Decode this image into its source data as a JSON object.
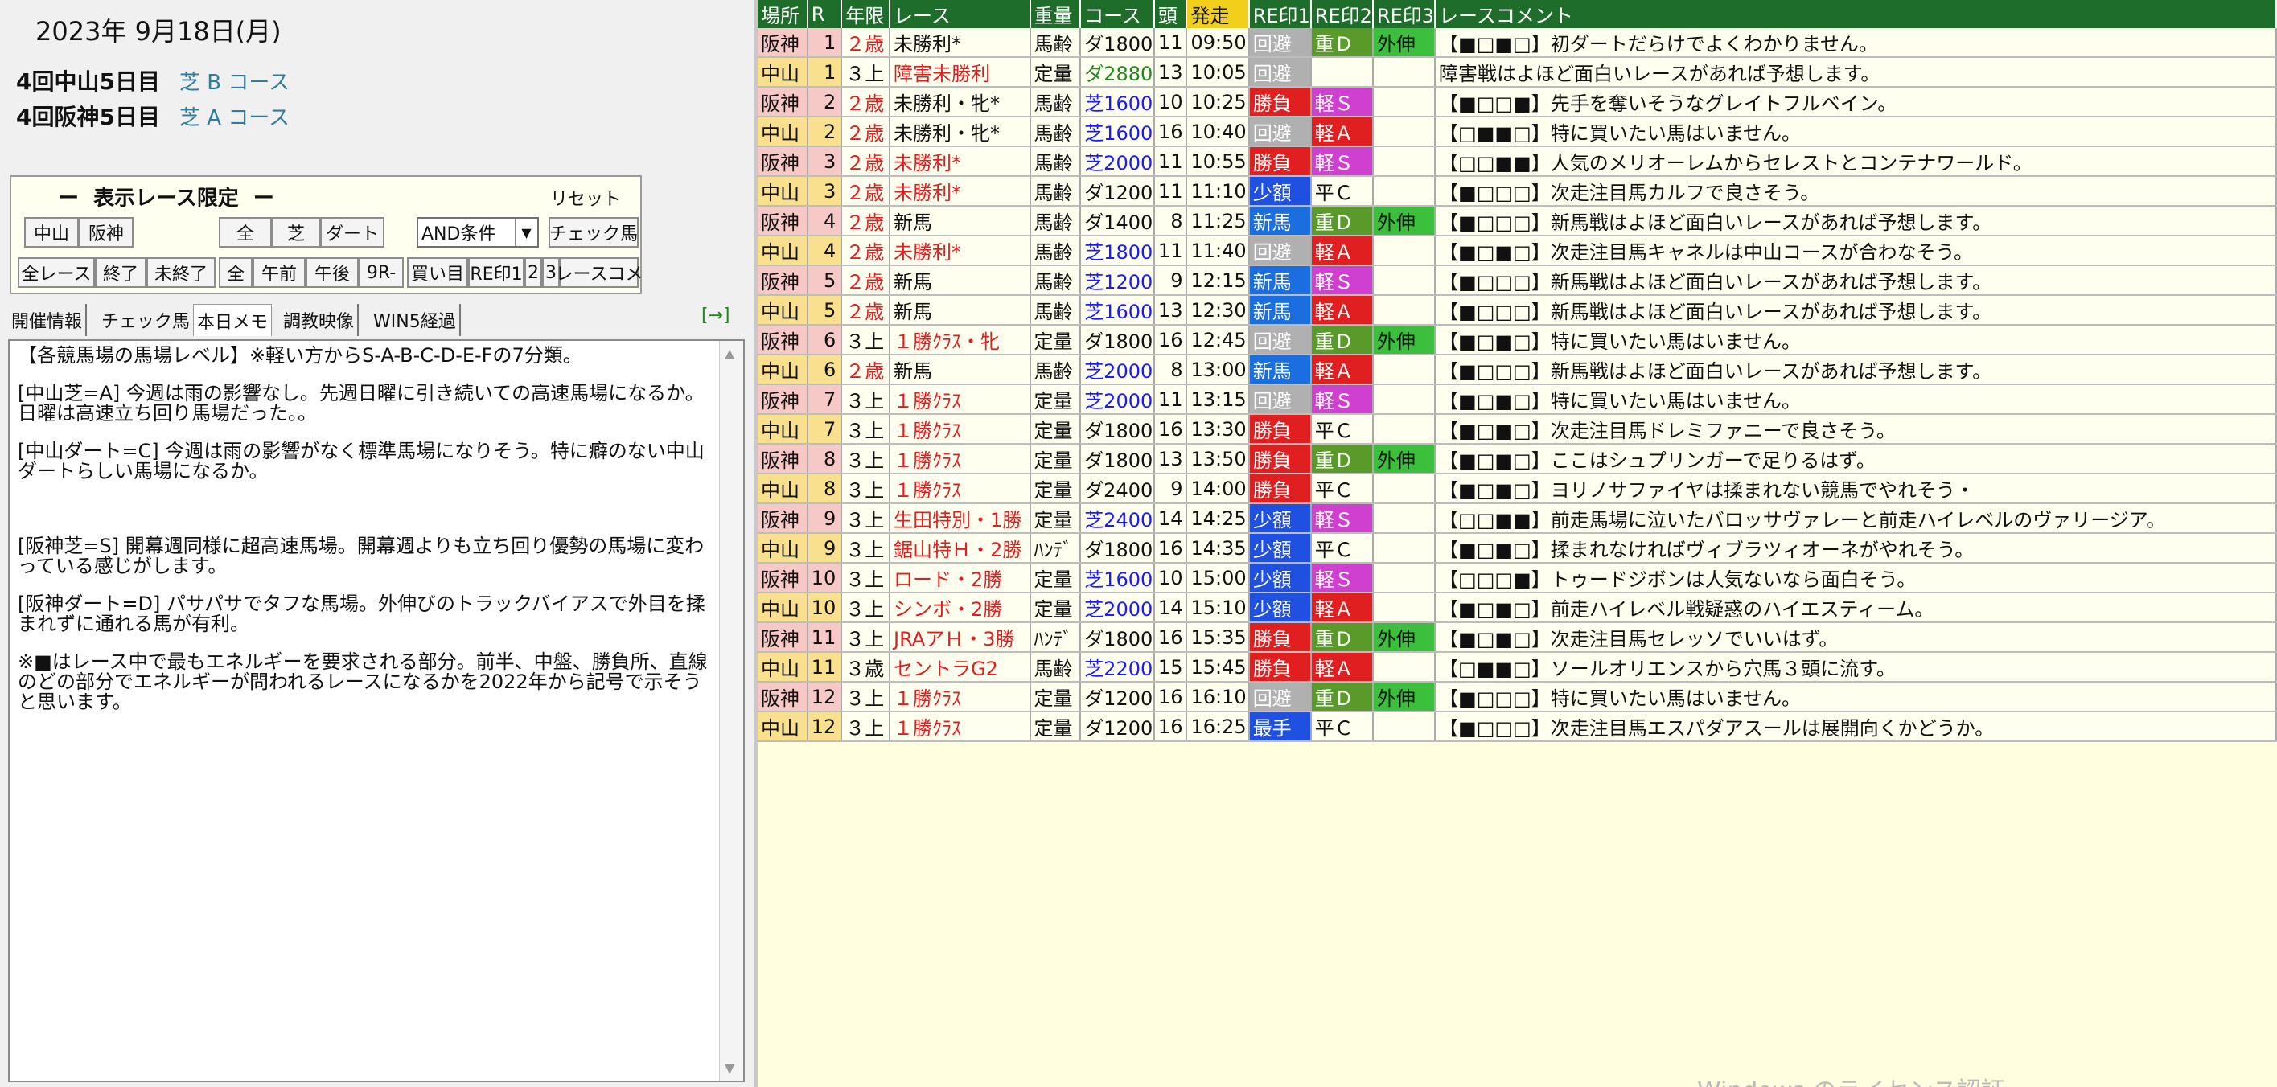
{
  "date": "2023年  9月18日(月)",
  "meetings": [
    {
      "name": "4回中山5日目",
      "course": "芝 B コース"
    },
    {
      "name": "4回阪神5日目",
      "course": "芝 A コース"
    }
  ],
  "filter": {
    "title": "ー  表示レース限定  ー",
    "reset": "リセット",
    "btn_nakayama": "中山",
    "btn_hanshin": "阪神",
    "btn_all": "全",
    "btn_turf": "芝",
    "btn_dirt": "ダート",
    "condition": "AND条件",
    "btn_check": "チェック馬",
    "btn_all_races": "全レース",
    "btn_finished": "終了",
    "btn_unfinished": "未終了",
    "btn_all2": "全",
    "btn_am": "午前",
    "btn_pm": "午後",
    "btn_9r": "9R-",
    "btn_buy": "買い目",
    "btn_rei1": "RE印1",
    "btn_2": "2",
    "btn_3": "3",
    "btn_comment": "レースコメ"
  },
  "tabs": {
    "t1": "開催情報",
    "t2": "チェック馬",
    "t3": "本日メモ",
    "t4": "調教映像",
    "t5": "WIN5経過",
    "arrow": "[→]"
  },
  "memo": [
    "【各競馬場の馬場レベル】※軽い方からS-A-B-C-D-E-Fの7分類。",
    "[中山芝=A] 今週は雨の影響なし。先週日曜に引き続いての高速馬場になるか。日曜は高速立ち回り馬場だった。。",
    "[中山ダート=C] 今週は雨の影響がなく標準馬場になりそう。特に癖のない中山ダートらしい馬場になるか。",
    "",
    "[阪神芝=S] 開幕週同様に超高速馬場。開幕週よりも立ち回り優勢の馬場に変わっている感じがします。",
    "[阪神ダート=D] パサパサでタフな馬場。外伸びのトラックバイアスで外目を揉まれずに通れる馬が有利。",
    "※■はレース中で最もエネルギーを要求される部分。前半、中盤、勝負所、直線のどの部分でエネルギーが問われるレースになるかを2022年から記号で示そうと思います。"
  ],
  "table": {
    "headers": [
      "場所",
      "R",
      "年限",
      "レース",
      "重量",
      "コース",
      "頭",
      "発走",
      "RE印1",
      "RE印2",
      "RE印3",
      "レースコメント"
    ],
    "rows": [
      {
        "place": "阪神",
        "r": "1",
        "age": "２歳",
        "race": "未勝利*",
        "weight": "馬齢",
        "course": "ダ1800",
        "heads": "11",
        "time": "09:50",
        "r1": "回避",
        "r2": "重Ｄ",
        "r3": "外伸",
        "comment": "【■□■□】初ダートだらけでよくわかりません。"
      },
      {
        "place": "中山",
        "r": "1",
        "age": "３上",
        "race": "障害未勝利",
        "weight": "定量",
        "course": "ダ2880",
        "heads": "13",
        "time": "10:05",
        "r1": "回避",
        "r2": "",
        "r3": "",
        "comment": "障害戦はよほど面白いレースがあれば予想します。"
      },
      {
        "place": "阪神",
        "r": "2",
        "age": "２歳",
        "race": "未勝利・牝*",
        "weight": "馬齢",
        "course": "芝1600",
        "heads": "10",
        "time": "10:25",
        "r1": "勝負",
        "r2": "軽Ｓ",
        "r3": "",
        "comment": "【■□□■】先手を奪いそうなグレイトフルベイン。"
      },
      {
        "place": "中山",
        "r": "2",
        "age": "２歳",
        "race": "未勝利・牝*",
        "weight": "馬齢",
        "course": "芝1600",
        "heads": "16",
        "time": "10:40",
        "r1": "回避",
        "r2": "軽Ａ",
        "r3": "",
        "comment": "【□■■□】特に買いたい馬はいません。"
      },
      {
        "place": "阪神",
        "r": "3",
        "age": "２歳",
        "race": "未勝利*",
        "weight": "馬齢",
        "course": "芝2000",
        "heads": "11",
        "time": "10:55",
        "r1": "勝負",
        "r2": "軽Ｓ",
        "r3": "",
        "comment": "【□□■■】人気のメリオーレムからセレストとコンテナワールド。"
      },
      {
        "place": "中山",
        "r": "3",
        "age": "２歳",
        "race": "未勝利*",
        "weight": "馬齢",
        "course": "ダ1200",
        "heads": "11",
        "time": "11:10",
        "r1": "少額",
        "r2": "平Ｃ",
        "r3": "",
        "comment": "【■□□□】次走注目馬カルフで良さそう。"
      },
      {
        "place": "阪神",
        "r": "4",
        "age": "２歳",
        "race": "新馬",
        "weight": "馬齢",
        "course": "ダ1400",
        "heads": "8",
        "time": "11:25",
        "r1": "新馬",
        "r2": "重Ｄ",
        "r3": "外伸",
        "comment": "【■□□□】新馬戦はよほど面白いレースがあれば予想します。"
      },
      {
        "place": "中山",
        "r": "4",
        "age": "２歳",
        "race": "未勝利*",
        "weight": "馬齢",
        "course": "芝1800",
        "heads": "11",
        "time": "11:40",
        "r1": "回避",
        "r2": "軽Ａ",
        "r3": "",
        "comment": "【■□■□】次走注目馬キャネルは中山コースが合わなそう。"
      },
      {
        "place": "阪神",
        "r": "5",
        "age": "２歳",
        "race": "新馬",
        "weight": "馬齢",
        "course": "芝1200",
        "heads": "9",
        "time": "12:15",
        "r1": "新馬",
        "r2": "軽Ｓ",
        "r3": "",
        "comment": "【■□□□】新馬戦はよほど面白いレースがあれば予想します。"
      },
      {
        "place": "中山",
        "r": "5",
        "age": "２歳",
        "race": "新馬",
        "weight": "馬齢",
        "course": "芝1600",
        "heads": "13",
        "time": "12:30",
        "r1": "新馬",
        "r2": "軽Ａ",
        "r3": "",
        "comment": "【■□□□】新馬戦はよほど面白いレースがあれば予想します。"
      },
      {
        "place": "阪神",
        "r": "6",
        "age": "３上",
        "race": "１勝ｸﾗｽ・牝",
        "weight": "定量",
        "course": "ダ1800",
        "heads": "16",
        "time": "12:45",
        "r1": "回避",
        "r2": "重Ｄ",
        "r3": "外伸",
        "comment": "【■□■□】特に買いたい馬はいません。"
      },
      {
        "place": "中山",
        "r": "6",
        "age": "２歳",
        "race": "新馬",
        "weight": "馬齢",
        "course": "芝2000",
        "heads": "8",
        "time": "13:00",
        "r1": "新馬",
        "r2": "軽Ａ",
        "r3": "",
        "comment": "【■□□□】新馬戦はよほど面白いレースがあれば予想します。"
      },
      {
        "place": "阪神",
        "r": "7",
        "age": "３上",
        "race": "１勝ｸﾗｽ",
        "weight": "定量",
        "course": "芝2000",
        "heads": "11",
        "time": "13:15",
        "r1": "回避",
        "r2": "軽Ｓ",
        "r3": "",
        "comment": "【■□■□】特に買いたい馬はいません。"
      },
      {
        "place": "中山",
        "r": "7",
        "age": "３上",
        "race": "１勝ｸﾗｽ",
        "weight": "定量",
        "course": "ダ1800",
        "heads": "16",
        "time": "13:30",
        "r1": "勝負",
        "r2": "平Ｃ",
        "r3": "",
        "comment": "【■□■□】次走注目馬ドレミファニーで良さそう。"
      },
      {
        "place": "阪神",
        "r": "8",
        "age": "３上",
        "race": "１勝ｸﾗｽ",
        "weight": "定量",
        "course": "ダ1800",
        "heads": "13",
        "time": "13:50",
        "r1": "勝負",
        "r2": "重Ｄ",
        "r3": "外伸",
        "comment": "【■□■□】ここはシュプリンガーで足りるはず。"
      },
      {
        "place": "中山",
        "r": "8",
        "age": "３上",
        "race": "１勝ｸﾗｽ",
        "weight": "定量",
        "course": "ダ2400",
        "heads": "9",
        "time": "14:00",
        "r1": "勝負",
        "r2": "平Ｃ",
        "r3": "",
        "comment": "【■□■□】ヨリノサファイヤは揉まれない競馬でやれそう・"
      },
      {
        "place": "阪神",
        "r": "9",
        "age": "３上",
        "race": "生田特別・1勝",
        "weight": "定量",
        "course": "芝2400",
        "heads": "14",
        "time": "14:25",
        "r1": "少額",
        "r2": "軽Ｓ",
        "r3": "",
        "comment": "【□□■■】前走馬場に泣いたバロッサヴァレーと前走ハイレベルのヴァリージア。"
      },
      {
        "place": "中山",
        "r": "9",
        "age": "３上",
        "race": "鋸山特Ｈ・2勝",
        "weight": "ﾊﾝﾃﾞ",
        "course": "ダ1800",
        "heads": "16",
        "time": "14:35",
        "r1": "少額",
        "r2": "平Ｃ",
        "r3": "",
        "comment": "【■□■□】揉まれなければヴィブラツィオーネがやれそう。"
      },
      {
        "place": "阪神",
        "r": "10",
        "age": "３上",
        "race": "ロード・2勝",
        "weight": "定量",
        "course": "芝1600",
        "heads": "10",
        "time": "15:00",
        "r1": "少額",
        "r2": "軽Ｓ",
        "r3": "",
        "comment": "【□□□■】トゥードジボンは人気ないなら面白そう。"
      },
      {
        "place": "中山",
        "r": "10",
        "age": "３上",
        "race": "シンボ・2勝",
        "weight": "定量",
        "course": "芝2000",
        "heads": "14",
        "time": "15:10",
        "r1": "少額",
        "r2": "軽Ａ",
        "r3": "",
        "comment": "【■□■□】前走ハイレベル戦疑惑のハイエスティーム。"
      },
      {
        "place": "阪神",
        "r": "11",
        "age": "３上",
        "race": "JRAアＨ・3勝",
        "weight": "ﾊﾝﾃﾞ",
        "course": "ダ1800",
        "heads": "16",
        "time": "15:35",
        "r1": "勝負",
        "r2": "重Ｄ",
        "r3": "外伸",
        "comment": "【■□■□】次走注目馬セレッソでいいはず。"
      },
      {
        "place": "中山",
        "r": "11",
        "age": "３歳",
        "race": "セントラG2",
        "weight": "馬齢",
        "course": "芝2200",
        "heads": "15",
        "time": "15:45",
        "r1": "勝負",
        "r2": "軽Ａ",
        "r3": "",
        "comment": "【□■■□】ソールオリエンスから穴馬３頭に流す。"
      },
      {
        "place": "阪神",
        "r": "12",
        "age": "３上",
        "race": "１勝ｸﾗｽ",
        "weight": "定量",
        "course": "ダ1200",
        "heads": "16",
        "time": "16:10",
        "r1": "回避",
        "r2": "重Ｄ",
        "r3": "外伸",
        "comment": "【■□□□】特に買いたい馬はいません。"
      },
      {
        "place": "中山",
        "r": "12",
        "age": "３上",
        "race": "１勝ｸﾗｽ",
        "weight": "定量",
        "course": "ダ1200",
        "heads": "16",
        "time": "16:25",
        "r1": "最手",
        "r2": "平Ｃ",
        "r3": "",
        "comment": "【■□□□】次走注目馬エスパダアスールは展開向くかどうか。"
      }
    ]
  },
  "watermark": "Windows のライセンス認証"
}
